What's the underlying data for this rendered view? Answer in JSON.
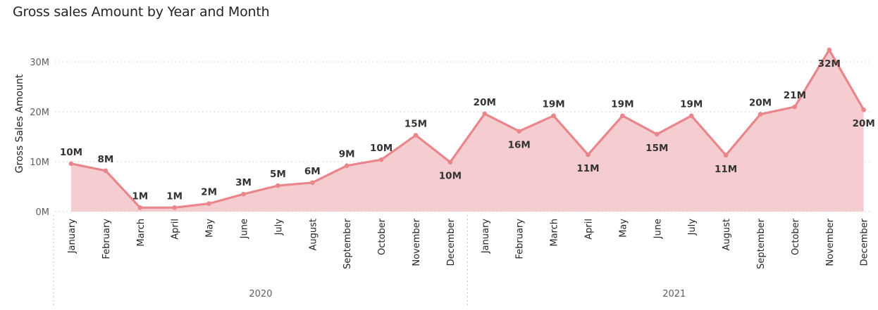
{
  "chart_data": {
    "type": "area",
    "title": "Gross sales Amount by Year and Month",
    "xlabel": "",
    "ylabel": "Gross Sales Amount",
    "ylim": [
      0,
      33
    ],
    "yunit": "M",
    "yticks": [
      {
        "value": 0,
        "label": "0M"
      },
      {
        "value": 10,
        "label": "10M"
      },
      {
        "value": 20,
        "label": "20M"
      },
      {
        "value": 30,
        "label": "30M"
      }
    ],
    "grid": true,
    "color": "#e8868c",
    "fill": "#f5cdd1",
    "categories": [
      "January",
      "February",
      "March",
      "April",
      "May",
      "June",
      "July",
      "August",
      "September",
      "October",
      "November",
      "December",
      "January",
      "February",
      "March",
      "April",
      "May",
      "June",
      "July",
      "August",
      "September",
      "October",
      "November",
      "December"
    ],
    "groups": [
      {
        "label": "2020",
        "count": 12
      },
      {
        "label": "2021",
        "count": 12
      }
    ],
    "values": [
      9.6,
      8.2,
      0.8,
      0.8,
      1.6,
      3.5,
      5.2,
      5.8,
      9.2,
      10.4,
      15.3,
      9.9,
      19.6,
      16.1,
      19.2,
      11.4,
      19.2,
      15.5,
      19.2,
      11.3,
      19.5,
      21.0,
      32.4,
      20.4
    ],
    "data_labels": [
      "10M",
      "8M",
      "1M",
      "1M",
      "2M",
      "3M",
      "5M",
      "6M",
      "9M",
      "10M",
      "15M",
      "10M",
      "20M",
      "16M",
      "19M",
      "11M",
      "19M",
      "15M",
      "19M",
      "11M",
      "20M",
      "21M",
      "32M",
      "20M"
    ],
    "label_positions": [
      "above",
      "above",
      "above",
      "above",
      "above",
      "above",
      "above",
      "above",
      "above",
      "above",
      "above",
      "below",
      "above",
      "below",
      "above",
      "below",
      "above",
      "below",
      "above",
      "below",
      "above",
      "above",
      "below",
      "below"
    ]
  }
}
